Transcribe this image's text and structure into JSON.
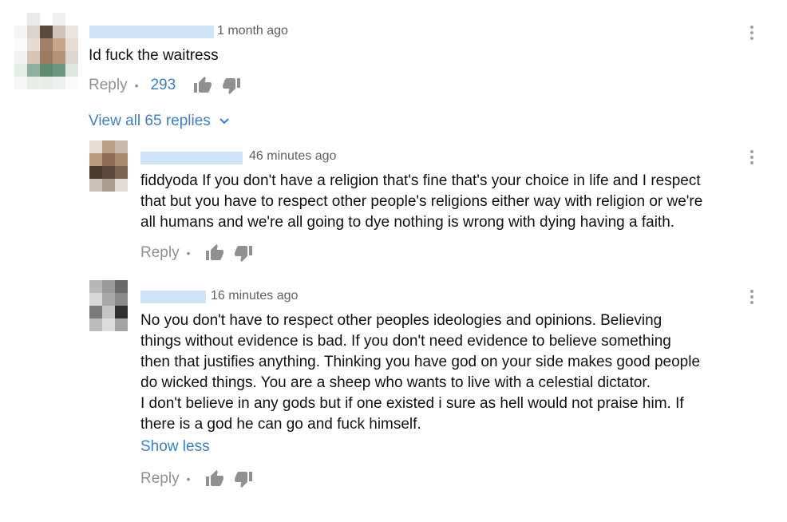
{
  "colors": {
    "link": "#3e7fc4",
    "meta": "#606060",
    "action": "#909090"
  },
  "comment": {
    "time": "1 month ago",
    "text": "Id fuck the waitress",
    "reply_label": "Reply",
    "likes": "293",
    "view_replies": "View all 65 replies"
  },
  "replies": [
    {
      "time": "46 minutes ago",
      "lines": [
        "fiddyoda If you don't have a religion that's fine that's your choice in life and I respect",
        "that but you have to respect other people's religions either way with religion or we're",
        "all humans and we're all going to dye nothing is wrong with dying having a faith."
      ],
      "reply_label": "Reply"
    },
    {
      "time": "16 minutes ago",
      "lines": [
        "No you don't have to respect other peoples ideologies and opinions. Believing",
        "things without evidence is bad. If you don't need evidence to believe something",
        "then that justifies anything. Thinking you have god on your side makes good people",
        "do wicked things. You are a sheep who wants to live with a celestial dictator.",
        "I don't believe in any gods but if one existed i sure as hell would not praise him. If",
        "there is a god he can go and fuck himself."
      ],
      "show_less": "Show less",
      "reply_label": "Reply"
    }
  ]
}
